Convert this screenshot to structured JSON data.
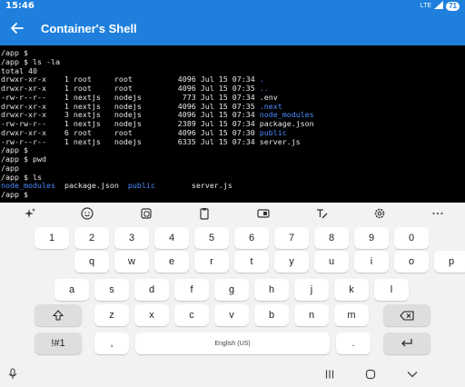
{
  "status": {
    "time": "15:46",
    "network": "LTE",
    "battery": "71"
  },
  "appbar": {
    "title": "Container's Shell",
    "back_icon": "arrow-back-icon"
  },
  "terminal": {
    "lines": [
      [
        {
          "t": "/app $ "
        }
      ],
      [
        {
          "t": "/app $ ls -la"
        }
      ],
      [
        {
          "t": "total 40"
        }
      ],
      [
        {
          "t": "drwxr-xr-x    1 root     root          4096 Jul 15 07:34 "
        },
        {
          "t": ".",
          "c": "blue"
        }
      ],
      [
        {
          "t": "drwxr-xr-x    1 root     root          4096 Jul 15 07:35 "
        },
        {
          "t": "..",
          "c": "blue"
        }
      ],
      [
        {
          "t": "-rw-r--r--    1 nextjs   nodejs         773 Jul 15 07:34 .env"
        }
      ],
      [
        {
          "t": "drwxr-xr-x    1 nextjs   nodejs        4096 Jul 15 07:35 "
        },
        {
          "t": ".next",
          "c": "blue"
        }
      ],
      [
        {
          "t": "drwxr-xr-x    3 nextjs   nodejs        4096 Jul 15 07:34 "
        },
        {
          "t": "node_modules",
          "c": "blue"
        }
      ],
      [
        {
          "t": "-rw-rw-r--    1 nextjs   nodejs        2389 Jul 15 07:34 package.json"
        }
      ],
      [
        {
          "t": "drwxr-xr-x    6 root     root          4096 Jul 15 07:30 "
        },
        {
          "t": "public",
          "c": "blue"
        }
      ],
      [
        {
          "t": "-rw-r--r--    1 nextjs   nodejs        6335 Jul 15 07:34 server.js"
        }
      ],
      [
        {
          "t": "/app $ "
        }
      ],
      [
        {
          "t": "/app $ pwd"
        }
      ],
      [
        {
          "t": "/app"
        }
      ],
      [
        {
          "t": "/app $ ls"
        }
      ],
      [
        {
          "t": "node_modules",
          "c": "blue"
        },
        {
          "t": "  package.json  "
        },
        {
          "t": "public",
          "c": "blue"
        },
        {
          "t": "        server.js"
        }
      ],
      [
        {
          "t": "/app $ "
        }
      ]
    ]
  },
  "keyboard": {
    "toolbar": [
      "sparkle-icon",
      "emoji-icon",
      "sticker-icon",
      "clipboard-icon",
      "one-handed-icon",
      "handwriting-icon",
      "settings-icon",
      "more-icon"
    ],
    "rows": [
      [
        "1",
        "2",
        "3",
        "4",
        "5",
        "6",
        "7",
        "8",
        "9",
        "0"
      ],
      [
        "q",
        "w",
        "e",
        "r",
        "t",
        "y",
        "u",
        "i",
        "o",
        "p"
      ],
      [
        "a",
        "s",
        "d",
        "f",
        "g",
        "h",
        "j",
        "k",
        "l"
      ],
      [
        "z",
        "x",
        "c",
        "v",
        "b",
        "n",
        "m"
      ]
    ],
    "symbols_label": "!#1",
    "comma_label": ",",
    "space_label": "English (US)",
    "period_label": ".",
    "colors": {
      "background": "#f2f2f2",
      "key": "#ffffff",
      "function_key": "#dedede",
      "accent": "#1e7fdd"
    }
  },
  "navbar": [
    "mic-icon",
    "recents-icon",
    "home-icon",
    "back-chevron-icon"
  ]
}
